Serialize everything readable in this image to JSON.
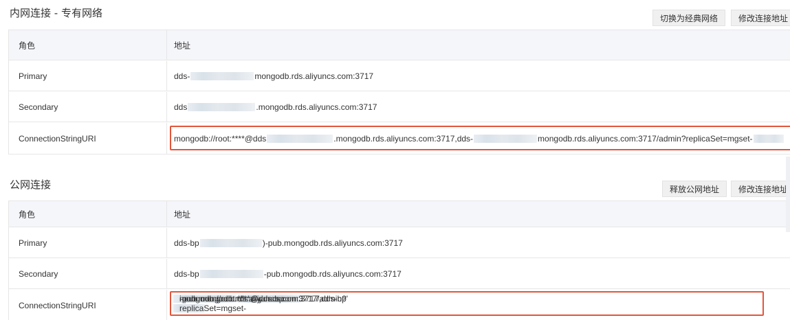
{
  "private_section": {
    "title": "内网连接 - 专有网络",
    "buttons": {
      "switch": "切换为经典网络",
      "modify": "修改连接地址"
    },
    "headers": {
      "role": "角色",
      "address": "地址"
    },
    "rows": [
      {
        "role": "Primary",
        "addr_prefix": "dds-",
        "addr_suffix": "mongodb.rds.aliyuncs.com:3717"
      },
      {
        "role": "Secondary",
        "addr_prefix": "dds",
        "addr_suffix": ".mongodb.rds.aliyuncs.com:3717"
      }
    ],
    "uri": {
      "role": "ConnectionStringURI",
      "part1": "mongodb://root:****@dds",
      "part2": ".mongodb.rds.aliyuncs.com:3717,dds-",
      "part3": "mongodb.rds.aliyuncs.com:3717/admin?replicaSet=mgset-"
    }
  },
  "public_section": {
    "title": "公网连接",
    "buttons": {
      "release": "释放公网地址",
      "modify": "修改连接地址"
    },
    "headers": {
      "role": "角色",
      "address": "地址"
    },
    "rows": [
      {
        "role": "Primary",
        "addr_prefix": "dds-bp",
        "addr_suffix": ")-pub.mongodb.rds.aliyuncs.com:3717"
      },
      {
        "role": "Secondary",
        "addr_prefix": "dds-bp",
        "addr_suffix": "-pub.mongodb.rds.aliyuncs.com:3717"
      }
    ],
    "uri": {
      "role": "ConnectionStringURI",
      "line1_part1": "mongodb://root:****@dds-bp",
      "line1_part2": "i-pub.mongodb.rds.aliyuncs.com:3717,dds-bp'",
      "line1_part3": "-pub.mongodb.rds.aliyuncs.com:3717/admin?",
      "line2_part1": "replicaSet=mgset-"
    }
  }
}
